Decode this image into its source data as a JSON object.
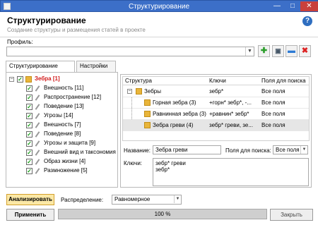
{
  "window": {
    "title": "Структурирование",
    "minimize": "—",
    "maximize": "□",
    "close": "✕"
  },
  "header": {
    "title": "Структурирование",
    "subtitle": "Создание структуры и размещения статей в проекте",
    "help": "?"
  },
  "profile": {
    "label": "Профиль:",
    "value": "",
    "dropdown_icon": "chevron-down-icon"
  },
  "toolbar": {
    "add": "✚",
    "save": "▣",
    "edit": "▬",
    "delete": "✖"
  },
  "tabs": [
    {
      "label": "Структурирование",
      "active": true
    },
    {
      "label": "Настройки",
      "active": false
    }
  ],
  "tree": {
    "root": {
      "label": "Зебра [1]",
      "checked": true
    },
    "items": [
      {
        "label": "Внешность [11]",
        "checked": true
      },
      {
        "label": "Распространение [12]",
        "checked": true
      },
      {
        "label": "Поведение [13]",
        "checked": true
      },
      {
        "label": "Угрозы [14]",
        "checked": true
      },
      {
        "label": "Внешность [7]",
        "checked": true
      },
      {
        "label": "Поведение [8]",
        "checked": true
      },
      {
        "label": "Угрозы и защита [9]",
        "checked": true
      },
      {
        "label": "Внешний вид и таксономия",
        "checked": true
      },
      {
        "label": "Образ жизни [4]",
        "checked": true
      },
      {
        "label": "Размножение [5]",
        "checked": true
      }
    ]
  },
  "grid": {
    "columns": [
      "Структура",
      "Ключи",
      "Поля для поиска"
    ],
    "rows": [
      {
        "structure": "Зебры",
        "keys": "зебр*",
        "fields": "Все поля"
      },
      {
        "structure": "Горная зебра (3)",
        "keys": "+горн* зебр*, -...",
        "fields": "Все поля"
      },
      {
        "structure": "Равнинная зебра (3)",
        "keys": "+равнин* зебр*",
        "fields": "Все поля"
      },
      {
        "structure": "Зебра греви (4)",
        "keys": "зебр* греви, зе...",
        "fields": "Все поля"
      }
    ]
  },
  "details": {
    "name_label": "Название:",
    "name_value": "Зебра греви",
    "search_label": "Поля для поиска:",
    "search_value": "Все поля",
    "keys_label": "Ключи:",
    "keys_line1": "зебр* греви",
    "keys_line2": "зебр*"
  },
  "bottom": {
    "analyze": "Анализировать",
    "distribution_label": "Распределение:",
    "distribution_value": "Равномерное",
    "apply": "Применить",
    "progress_text": "100 %",
    "progress_value": 1.0,
    "close": "Закрыть"
  },
  "colors": {
    "title_bar": "#3c6fc8",
    "root_label": "#d21b1b",
    "analyze_bg": "#fbe8a6"
  }
}
